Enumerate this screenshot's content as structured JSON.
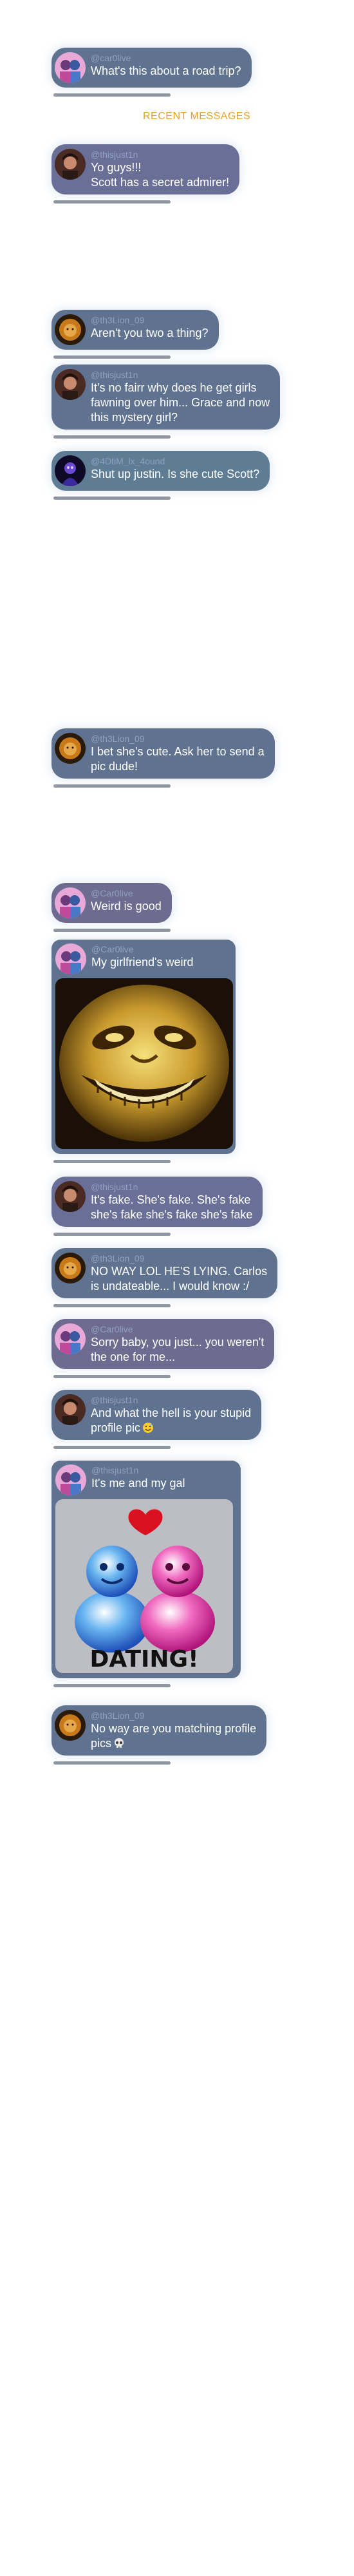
{
  "section_label": "RECENT MESSAGES",
  "messages": [
    {
      "user": "@car0live",
      "lines": [
        "What's this about a road trip?"
      ]
    },
    {
      "user": "@thisjust1n",
      "lines": [
        "Yo guys!!!",
        "Scott has a secret admirer!"
      ]
    },
    {
      "user": "@th3Lion_09",
      "lines": [
        "Aren't you two a thing?"
      ]
    },
    {
      "user": "@thisjust1n",
      "lines": [
        "It's no fairr why does he get girls",
        "fawning over him... Grace and now",
        "this mystery girl?"
      ]
    },
    {
      "user": "@4DtiM_lx_4ound",
      "lines": [
        "Shut up justin. Is she cute Scott?"
      ]
    },
    {
      "user": "@th3Lion_09",
      "lines": [
        "I bet she's cute. Ask her to send a",
        "pic dude!"
      ]
    },
    {
      "user": "@Car0live",
      "lines": [
        "Weird is good"
      ]
    },
    {
      "user": "@Car0live",
      "lines": [
        "My girlfriend's weird"
      ]
    },
    {
      "user": "@thisjust1n",
      "lines": [
        "It's fake. She's fake. She's fake",
        "she's fake she's fake she's fake"
      ]
    },
    {
      "user": "@th3Lion_09",
      "lines": [
        "NO WAY LOL HE'S LYING. Carlos",
        "is undateable... I would know :/"
      ]
    },
    {
      "user": "@Car0live",
      "lines": [
        "Sorry baby, you just... you weren't",
        "the one for me..."
      ]
    },
    {
      "user": "@thisjust1n",
      "lines": [
        "And what the hell is your stupid",
        "profile pic"
      ]
    },
    {
      "user": "@thisjust1n",
      "lines": [
        "It's me and my gal"
      ],
      "image_text": "DATING!"
    },
    {
      "user": "@th3Lion_09",
      "lines": [
        "No way are you matching profile",
        "pics"
      ]
    }
  ],
  "icons": {
    "avatar_carolive": "avatar-two-girls-icon",
    "avatar_justin": "avatar-dark-hair-icon",
    "avatar_lion": "avatar-lion-icon",
    "avatar_dim": "avatar-purple-figure-icon",
    "emoji_sweat": "sweat-smile-icon",
    "emoji_skull": "skull-icon"
  }
}
